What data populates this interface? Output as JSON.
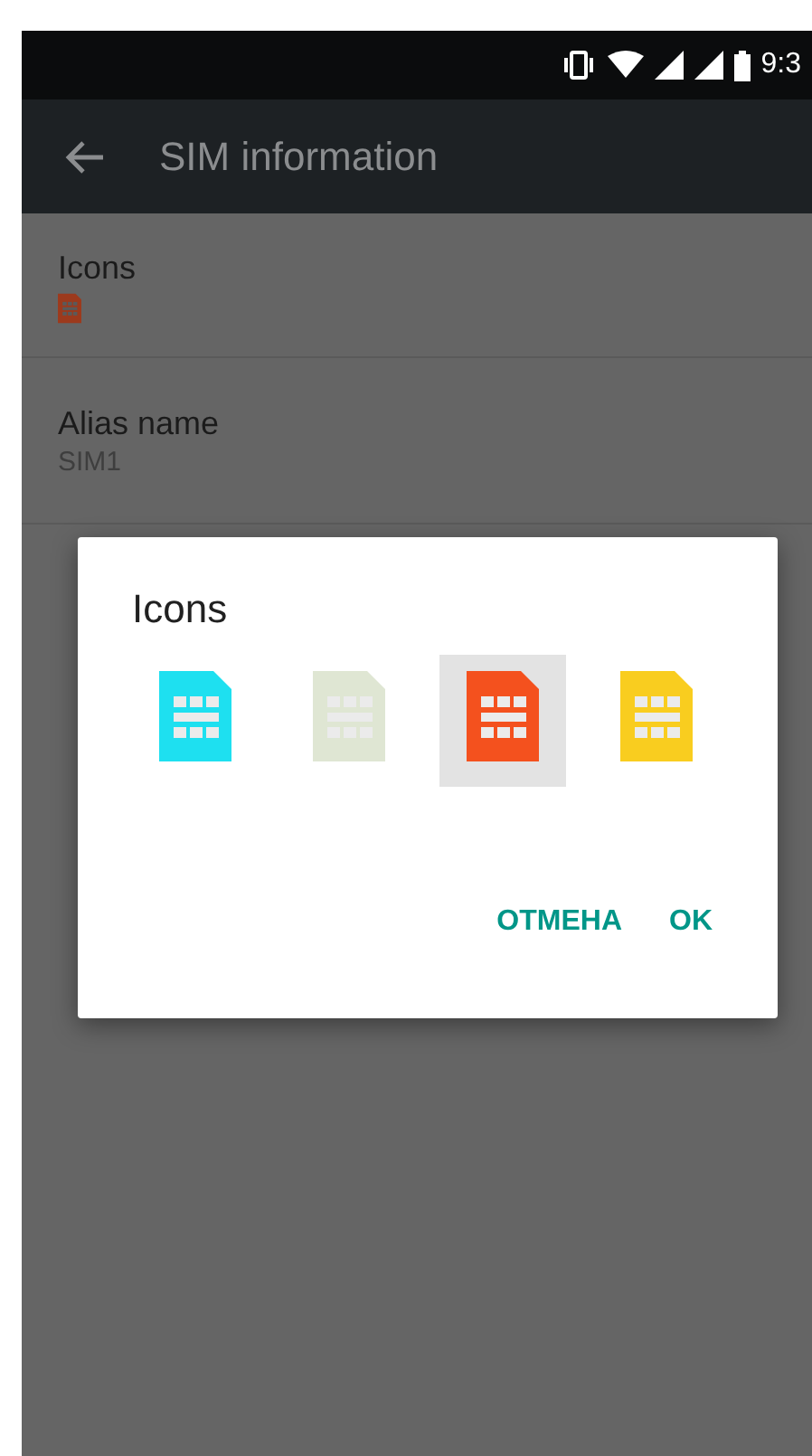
{
  "status_bar": {
    "time": "9:3"
  },
  "app_bar": {
    "title": "SIM information"
  },
  "settings": [
    {
      "kind": "icon",
      "title": "Icons",
      "color": "#9c3a1d"
    },
    {
      "kind": "text",
      "title": "Alias name",
      "summary": "SIM1"
    }
  ],
  "dialog": {
    "title": "Icons",
    "icons": [
      {
        "color": "#1ee0f0",
        "selected": false
      },
      {
        "color": "#dfe6d3",
        "selected": false
      },
      {
        "color": "#f4511e",
        "selected": true
      },
      {
        "color": "#f9cd1f",
        "selected": false
      }
    ],
    "buttons": [
      "ОТМЕНА",
      "OK"
    ]
  }
}
